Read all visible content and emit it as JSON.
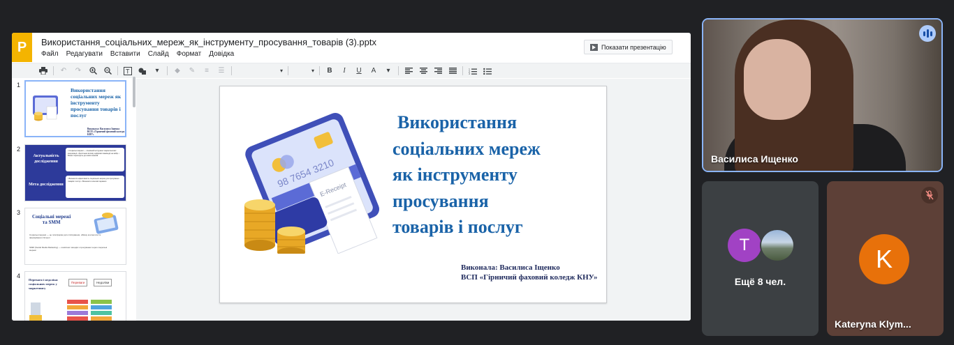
{
  "presentation": {
    "app_icon_letter": "P",
    "doc_title": "Використання_соціальних_мереж_як_інструменту_просування_товарів (3).pptx",
    "menu": [
      "Файл",
      "Редагувати",
      "Вставити",
      "Слайд",
      "Формат",
      "Довідка"
    ],
    "present_button": "Показати презентацію",
    "toolbar_icons": [
      "print-icon",
      "undo-icon",
      "redo-icon",
      "zoom-in-icon",
      "zoom-out-icon",
      "text-box-icon",
      "shape-icon",
      "fill-icon",
      "pen-icon",
      "line-weight-icon",
      "line-dash-icon",
      "font-select",
      "font-size-select",
      "bold-icon",
      "italic-icon",
      "underline-icon",
      "text-color-icon",
      "align-left-icon",
      "align-center-icon",
      "align-right-icon",
      "align-justify-icon",
      "numbered-list-icon",
      "bulleted-list-icon"
    ],
    "format": {
      "bold": "B",
      "italic": "I",
      "underline": "U",
      "text_color": "A"
    }
  },
  "thumbnails": [
    {
      "num": "1",
      "title": "Використання соціальних мереж як інструменту просування товарів і послуг",
      "subtitle_line1": "Виконала: Василиса Іщенко",
      "subtitle_line2": "ВСП «Гірничий фаховий коледж КНУ»"
    },
    {
      "num": "2",
      "heading1": "Актуальність дослідження",
      "heading2": "Мета дослідження",
      "box1": "• Соціальні мережі — основний інструмент маркетингової комунікації • Зростання впливу цифрової взаємодії на вибір • Бізнес переходить до нових каналів",
      "box2": "• Визначити ефективність соціальних мереж для просування товарів і послуг • Визначити ключові переваги"
    },
    {
      "num": "3",
      "title_line1": "Соціальні мережі",
      "title_line2": "та SMM",
      "text1": "Соціальні мережі — це платформи для спілкування, обміну контентом та формування спільнот",
      "text2": "SMM (Social Media Marketing) — комплекс заходів з просування через соціальні мережі"
    },
    {
      "num": "4",
      "title": "Переваги і недоліки соціальних мереж у маркетингу",
      "label_pros": "Переваги",
      "label_cons": "Недоліки"
    }
  ],
  "slide": {
    "title_lines": [
      "Використання",
      "соціальних мереж",
      "як інструменту",
      "просування",
      "товарів і послуг"
    ],
    "author_line1": "Виконала: Василиса Іщенко",
    "author_line2": "ВСП «Гірничий фаховий коледж КНУ»",
    "card_number": "98 7654 3210",
    "receipt_label": "E-Receipt"
  },
  "participants": {
    "main_name": "Василиса Ищенко",
    "more_avatar_letter": "T",
    "more_label": "Ещё 8 чел.",
    "k_letter": "K",
    "k_name": "Kateryna Klym..."
  },
  "colors": {
    "title_blue": "#1a63a8",
    "active_speaker_border": "#8ab4f8",
    "avatar_purple": "#a142c4",
    "avatar_orange": "#e8710a"
  }
}
